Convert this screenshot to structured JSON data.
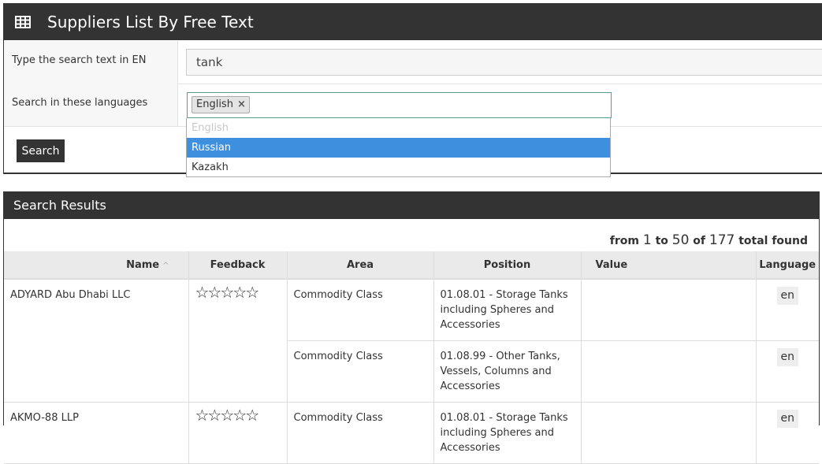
{
  "header": {
    "title": "Suppliers List By Free Text",
    "icon": "table-grid-icon"
  },
  "form": {
    "search_label": "Type the search text in EN",
    "search_value": "tank",
    "languages_label": "Search in these languages",
    "selected_languages": [
      "English"
    ],
    "remove_glyph": "×",
    "search_button": "Search"
  },
  "dropdown": {
    "options": [
      {
        "label": "English",
        "state": "disabled"
      },
      {
        "label": "Russian",
        "state": "highlighted"
      },
      {
        "label": "Kazakh",
        "state": "normal"
      }
    ]
  },
  "results": {
    "title": "Search Results",
    "found": {
      "from_word": "from",
      "start": "1",
      "to_word": "to",
      "end": "50",
      "of_word": "of",
      "total": "177",
      "suffix": "total found"
    },
    "columns": [
      "Name",
      "Feedback",
      "Area",
      "Position",
      "Value",
      "Language"
    ],
    "sort_caret": "^",
    "rows": [
      {
        "name": "ADYARD Abu Dhabi LLC",
        "feedback_stars": 0,
        "area": "Commodity Class",
        "position": "01.08.01 - Storage Tanks including Spheres and Accessories",
        "value": "",
        "language": "en"
      },
      {
        "name": "",
        "feedback_stars": null,
        "area": "Commodity Class",
        "position": "01.08.99 - Other Tanks, Vessels, Columns and Accessories",
        "value": "",
        "language": "en"
      },
      {
        "name": "AKMO-88 LLP",
        "feedback_stars": 0,
        "area": "Commodity Class",
        "position": "01.08.01 - Storage Tanks including Spheres and Accessories",
        "value": "",
        "language": "en"
      }
    ]
  },
  "colors": {
    "header_bg": "#333333",
    "highlight": "#3f8fdf"
  }
}
